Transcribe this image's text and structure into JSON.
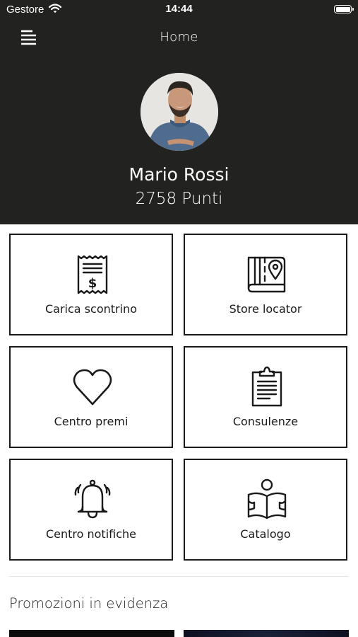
{
  "status_bar": {
    "carrier": "Gestore",
    "time": "14:44"
  },
  "header": {
    "title": "Home",
    "user_name": "Mario Rossi",
    "points": "2758 Punti"
  },
  "menu": [
    {
      "label": "Carica scontrino",
      "icon": "receipt-icon"
    },
    {
      "label": "Store locator",
      "icon": "map-pin-icon"
    },
    {
      "label": "Centro premi",
      "icon": "heart-icon"
    },
    {
      "label": "Consulenze",
      "icon": "clipboard-icon"
    },
    {
      "label": "Centro notifiche",
      "icon": "bell-icon"
    },
    {
      "label": "Catalogo",
      "icon": "catalog-reader-icon"
    }
  ],
  "promotions": {
    "title": "Promozioni in evidenza"
  },
  "colors": {
    "header_bg": "#222221",
    "text": "#1a1a1a",
    "background": "#ffffff"
  }
}
